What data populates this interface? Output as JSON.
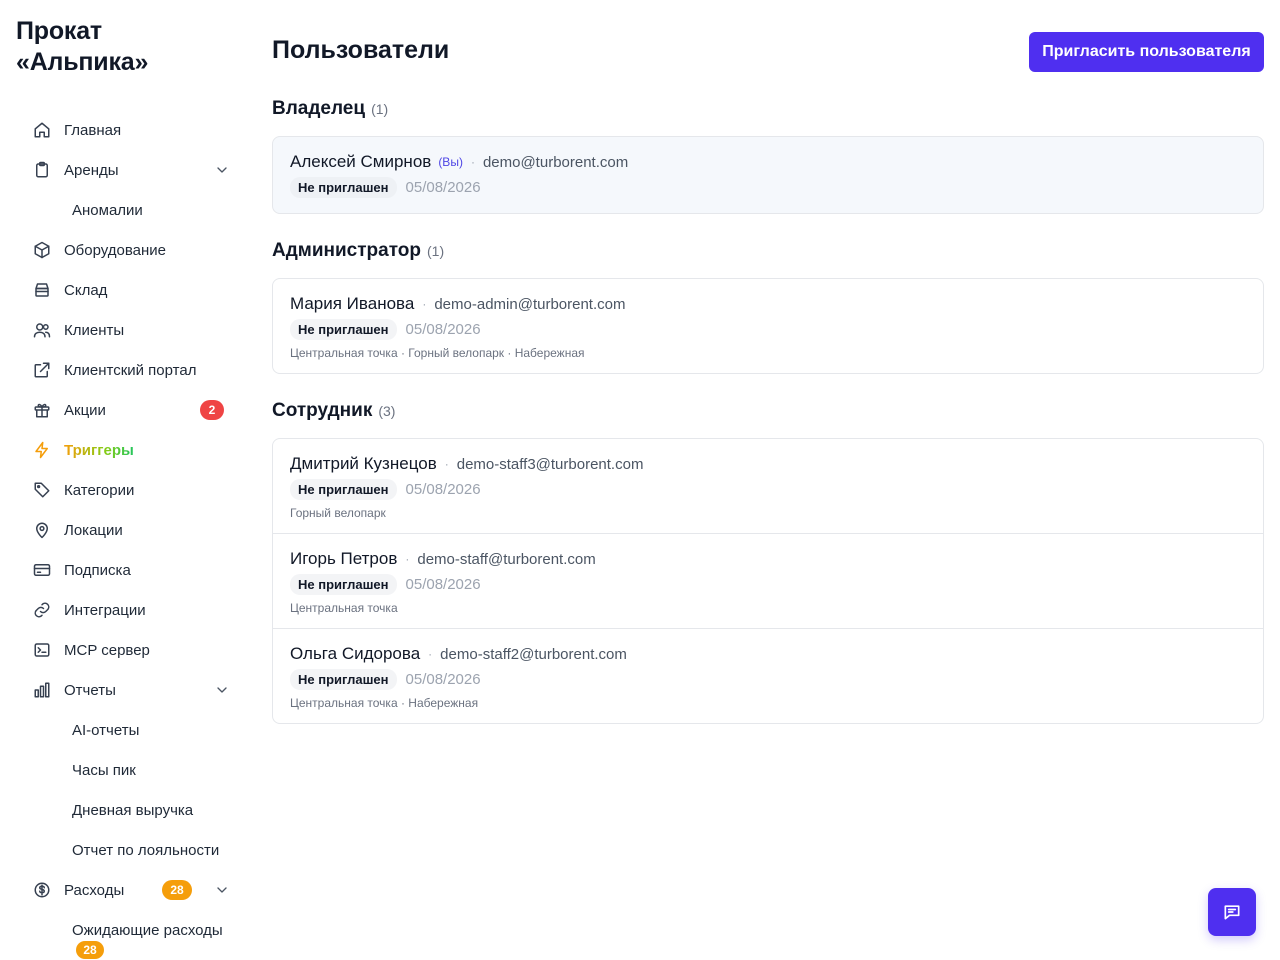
{
  "brand": {
    "line1": "Прокат",
    "line2": "«Альпика»"
  },
  "nav": {
    "home": "Главная",
    "rentals": "Аренды",
    "anomalies": "Аномалии",
    "equipment": "Оборудование",
    "warehouse": "Склад",
    "clients": "Клиенты",
    "portal": "Клиентский портал",
    "promos": "Акции",
    "promos_badge": "2",
    "triggers": "Триггеры",
    "categories": "Категории",
    "locations": "Локации",
    "subscription": "Подписка",
    "integrations": "Интеграции",
    "mcp": "MCP сервер",
    "reports": "Отчеты",
    "ai_reports": "AI-отчеты",
    "peak_hours": "Часы пик",
    "daily_revenue": "Дневная выручка",
    "loyalty_report": "Отчет по лояльности",
    "expenses": "Расходы",
    "expenses_badge": "28",
    "pending_expenses": "Ожидающие расходы",
    "pending_badge": "28"
  },
  "header": {
    "title": "Пользователи",
    "invite_label": "Пригласить пользователя"
  },
  "sections": {
    "owner": {
      "title": "Владелец",
      "count": "(1)",
      "users": [
        {
          "name": "Алексей Смирнов",
          "you": "(Вы)",
          "email": "demo@turborent.com",
          "status": "Не приглашен",
          "date": "05/08/2026"
        }
      ]
    },
    "admin": {
      "title": "Администратор",
      "count": "(1)",
      "users": [
        {
          "name": "Мария Иванова",
          "email": "demo-admin@turborent.com",
          "status": "Не приглашен",
          "date": "05/08/2026",
          "locations": "Центральная точка · Горный велопарк · Набережная"
        }
      ]
    },
    "staff": {
      "title": "Сотрудник",
      "count": "(3)",
      "users": [
        {
          "name": "Дмитрий Кузнецов",
          "email": "demo-staff3@turborent.com",
          "status": "Не приглашен",
          "date": "05/08/2026",
          "locations": "Горный велопарк"
        },
        {
          "name": "Игорь Петров",
          "email": "demo-staff@turborent.com",
          "status": "Не приглашен",
          "date": "05/08/2026",
          "locations": "Центральная точка"
        },
        {
          "name": "Ольга Сидорова",
          "email": "demo-staff2@turborent.com",
          "status": "Не приглашен",
          "date": "05/08/2026",
          "locations": "Центральная точка · Набережная"
        }
      ]
    }
  },
  "separator": "·",
  "icons": {
    "home": "home-icon",
    "rentals": "clipboard-icon",
    "equipment": "box-icon",
    "warehouse": "archive-icon",
    "clients": "users-icon",
    "portal": "external-link-icon",
    "promos": "gift-icon",
    "triggers": "zap-icon",
    "categories": "tag-icon",
    "locations": "map-pin-icon",
    "subscription": "credit-card-icon",
    "integrations": "link-icon",
    "mcp": "terminal-icon",
    "reports": "bar-chart-icon",
    "expenses": "dollar-circle-icon",
    "chat": "chat-icon"
  },
  "colors": {
    "accent": "#4f2ff0",
    "badge_red": "#ef4444",
    "badge_orange": "#f59e0b"
  }
}
